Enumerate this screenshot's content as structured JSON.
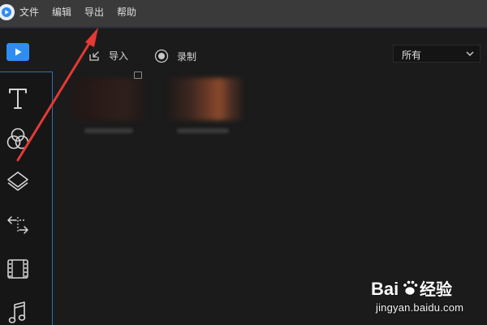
{
  "menubar": {
    "items": [
      {
        "label": "文件"
      },
      {
        "label": "编辑"
      },
      {
        "label": "导出"
      },
      {
        "label": "帮助"
      }
    ]
  },
  "sidebar": {
    "icons": [
      "text-icon",
      "filter-icon",
      "layers-icon",
      "transition-icon",
      "film-icon",
      "music-icon"
    ]
  },
  "toolbar": {
    "import_label": "导入",
    "record_label": "录制",
    "filter_select": {
      "selected": "所有"
    }
  },
  "watermark": {
    "brand_text": "Bai经验",
    "url": "jingyan.baidu.com"
  },
  "colors": {
    "accent": "#2f8cf1",
    "menubar_bg": "#3a3a3a",
    "annotation_arrow": "#e53935"
  }
}
